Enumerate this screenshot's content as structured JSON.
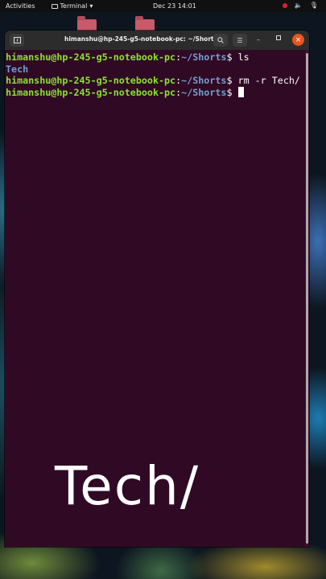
{
  "topbar": {
    "activities": "Activities",
    "app_menu": "Terminal",
    "clock": "Dec 23  14:01"
  },
  "window": {
    "title": "himanshu@hp-245-g5-notebook-pc: ~/Shorts"
  },
  "terminal": {
    "lines": [
      {
        "user": "himanshu@hp-245-g5-notebook-pc",
        "sep": ":",
        "path": "~/Shorts",
        "prompt": "$ ",
        "command": "ls"
      },
      {
        "output": "Tech"
      },
      {
        "user": "himanshu@hp-245-g5-notebook-pc",
        "sep": ":",
        "path": "~/Shorts",
        "prompt": "$ ",
        "command": "rm -r Tech/"
      },
      {
        "user": "himanshu@hp-245-g5-notebook-pc",
        "sep": ":",
        "path": "~/Shorts",
        "prompt": "$ ",
        "command": ""
      }
    ]
  },
  "caption": "Tech/",
  "colors": {
    "terminal_bg": "#300a24",
    "user_green": "#8ae234",
    "path_blue": "#729fcf",
    "close_orange": "#e95420"
  }
}
